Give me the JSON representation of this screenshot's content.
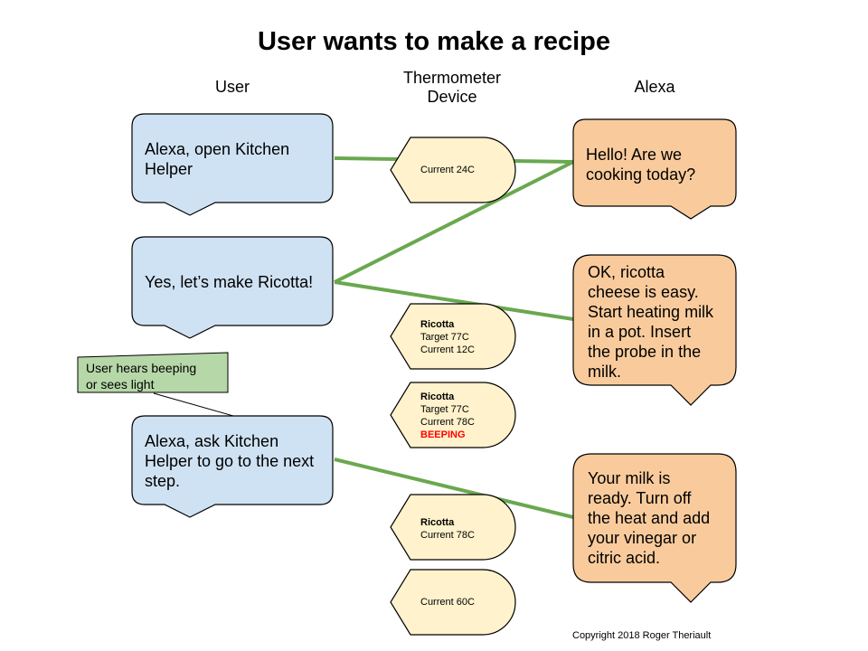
{
  "title": "User wants to make a recipe",
  "columns": {
    "user": "User",
    "thermometer_line1": "Thermometer",
    "thermometer_line2": "Device",
    "alexa": "Alexa"
  },
  "colors": {
    "user_fill": "#cfe2f3",
    "alexa_fill": "#f9cb9c",
    "therm_fill": "#fff2cc",
    "note_fill": "#b6d7a8",
    "connector": "#6aa84f",
    "alert": "#ff0000"
  },
  "user_bubbles": [
    {
      "lines": [
        "Alexa, open Kitchen",
        "Helper"
      ]
    },
    {
      "lines": [
        "Yes, let’s make Ricotta!"
      ]
    },
    {
      "lines": [
        "Alexa, ask Kitchen",
        "Helper to go to the next",
        "step."
      ]
    }
  ],
  "alexa_bubbles": [
    {
      "lines": [
        "Hello! Are we",
        "cooking today?"
      ]
    },
    {
      "lines": [
        "OK, ricotta",
        "cheese is easy.",
        "Start heating milk",
        "in a pot. Insert",
        "the probe in the",
        "milk."
      ]
    },
    {
      "lines": [
        "Your milk is",
        "ready. Turn off",
        "the heat and add",
        "your vinegar or",
        "citric acid."
      ]
    }
  ],
  "thermometer_states": [
    {
      "title": "",
      "lines": [
        "Current 24C"
      ],
      "alert": ""
    },
    {
      "title": "Ricotta",
      "lines": [
        "Target 77C",
        "Current 12C"
      ],
      "alert": ""
    },
    {
      "title": "Ricotta",
      "lines": [
        "Target 77C",
        "Current 78C"
      ],
      "alert": "BEEPING"
    },
    {
      "title": "Ricotta",
      "lines": [
        "Current 78C"
      ],
      "alert": ""
    },
    {
      "title": "",
      "lines": [
        "Current 60C"
      ],
      "alert": ""
    }
  ],
  "note": {
    "lines": [
      "User hears beeping",
      "or sees light"
    ]
  },
  "copyright": "Copyright 2018 Roger Theriault"
}
